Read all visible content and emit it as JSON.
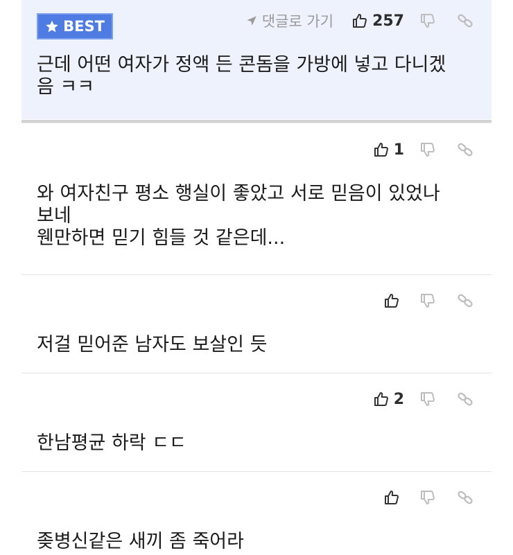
{
  "comments": [
    {
      "best_label": "BEST",
      "goto_label": "댓글로 가기",
      "likes": "257",
      "text": "근데 어떤 여자가 정액 든 콘돔을 가방에 넣고 다니겠\n음 ㅋㅋ"
    },
    {
      "likes": "1",
      "text": "와 여자친구 평소 행실이 좋았고 서로 믿음이 있었나\n보네\n웬만하면 믿기 힘들 것 같은데..."
    },
    {
      "likes": "",
      "text": "저걸 믿어준 남자도 보살인 듯"
    },
    {
      "likes": "2",
      "text": "한남평균 하락 ㄷㄷ"
    },
    {
      "likes": "",
      "text": "좆병신같은 새끼 좀 죽어라"
    }
  ],
  "icons": {
    "like": "thumbs-up-icon",
    "dislike": "thumbs-down-icon",
    "link": "link-icon",
    "goto": "arrow-icon",
    "best": "star-icon"
  },
  "colors": {
    "best_bg": "#eef2fc",
    "badge": "#4f7ce3"
  }
}
